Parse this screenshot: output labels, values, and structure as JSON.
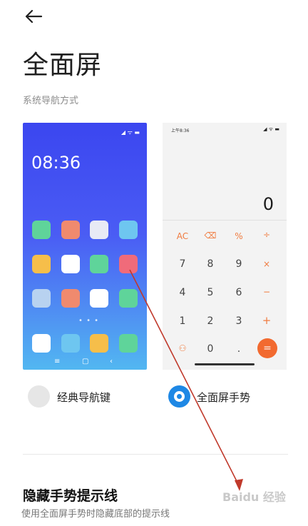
{
  "header": {
    "title": "全面屏",
    "subtitle": "系统导航方式"
  },
  "preview_left": {
    "clock": "08:36",
    "dots": "• • •",
    "nav_icons": [
      "≡",
      "▢",
      "‹"
    ]
  },
  "preview_right": {
    "time": "上午8:36",
    "status_icons": "◢ ᯤ ▬",
    "display": "0",
    "keys": [
      [
        "AC",
        "⌫",
        "%",
        "÷"
      ],
      [
        "7",
        "8",
        "9",
        "×"
      ],
      [
        "4",
        "5",
        "6",
        "−"
      ],
      [
        "1",
        "2",
        "3",
        "+"
      ],
      [
        "⚇",
        "0",
        ".",
        "="
      ]
    ]
  },
  "options": [
    {
      "label": "经典导航键",
      "selected": false
    },
    {
      "label": "全面屏手势",
      "selected": true
    }
  ],
  "section": {
    "title": "隐藏手势提示线",
    "description": "使用全面屏手势时隐藏底部的提示线"
  },
  "watermark": "Baidu 经验",
  "colors": {
    "accent": "#1e88e5",
    "calc_operator": "#f07b3f",
    "arrow": "#c0392b"
  }
}
